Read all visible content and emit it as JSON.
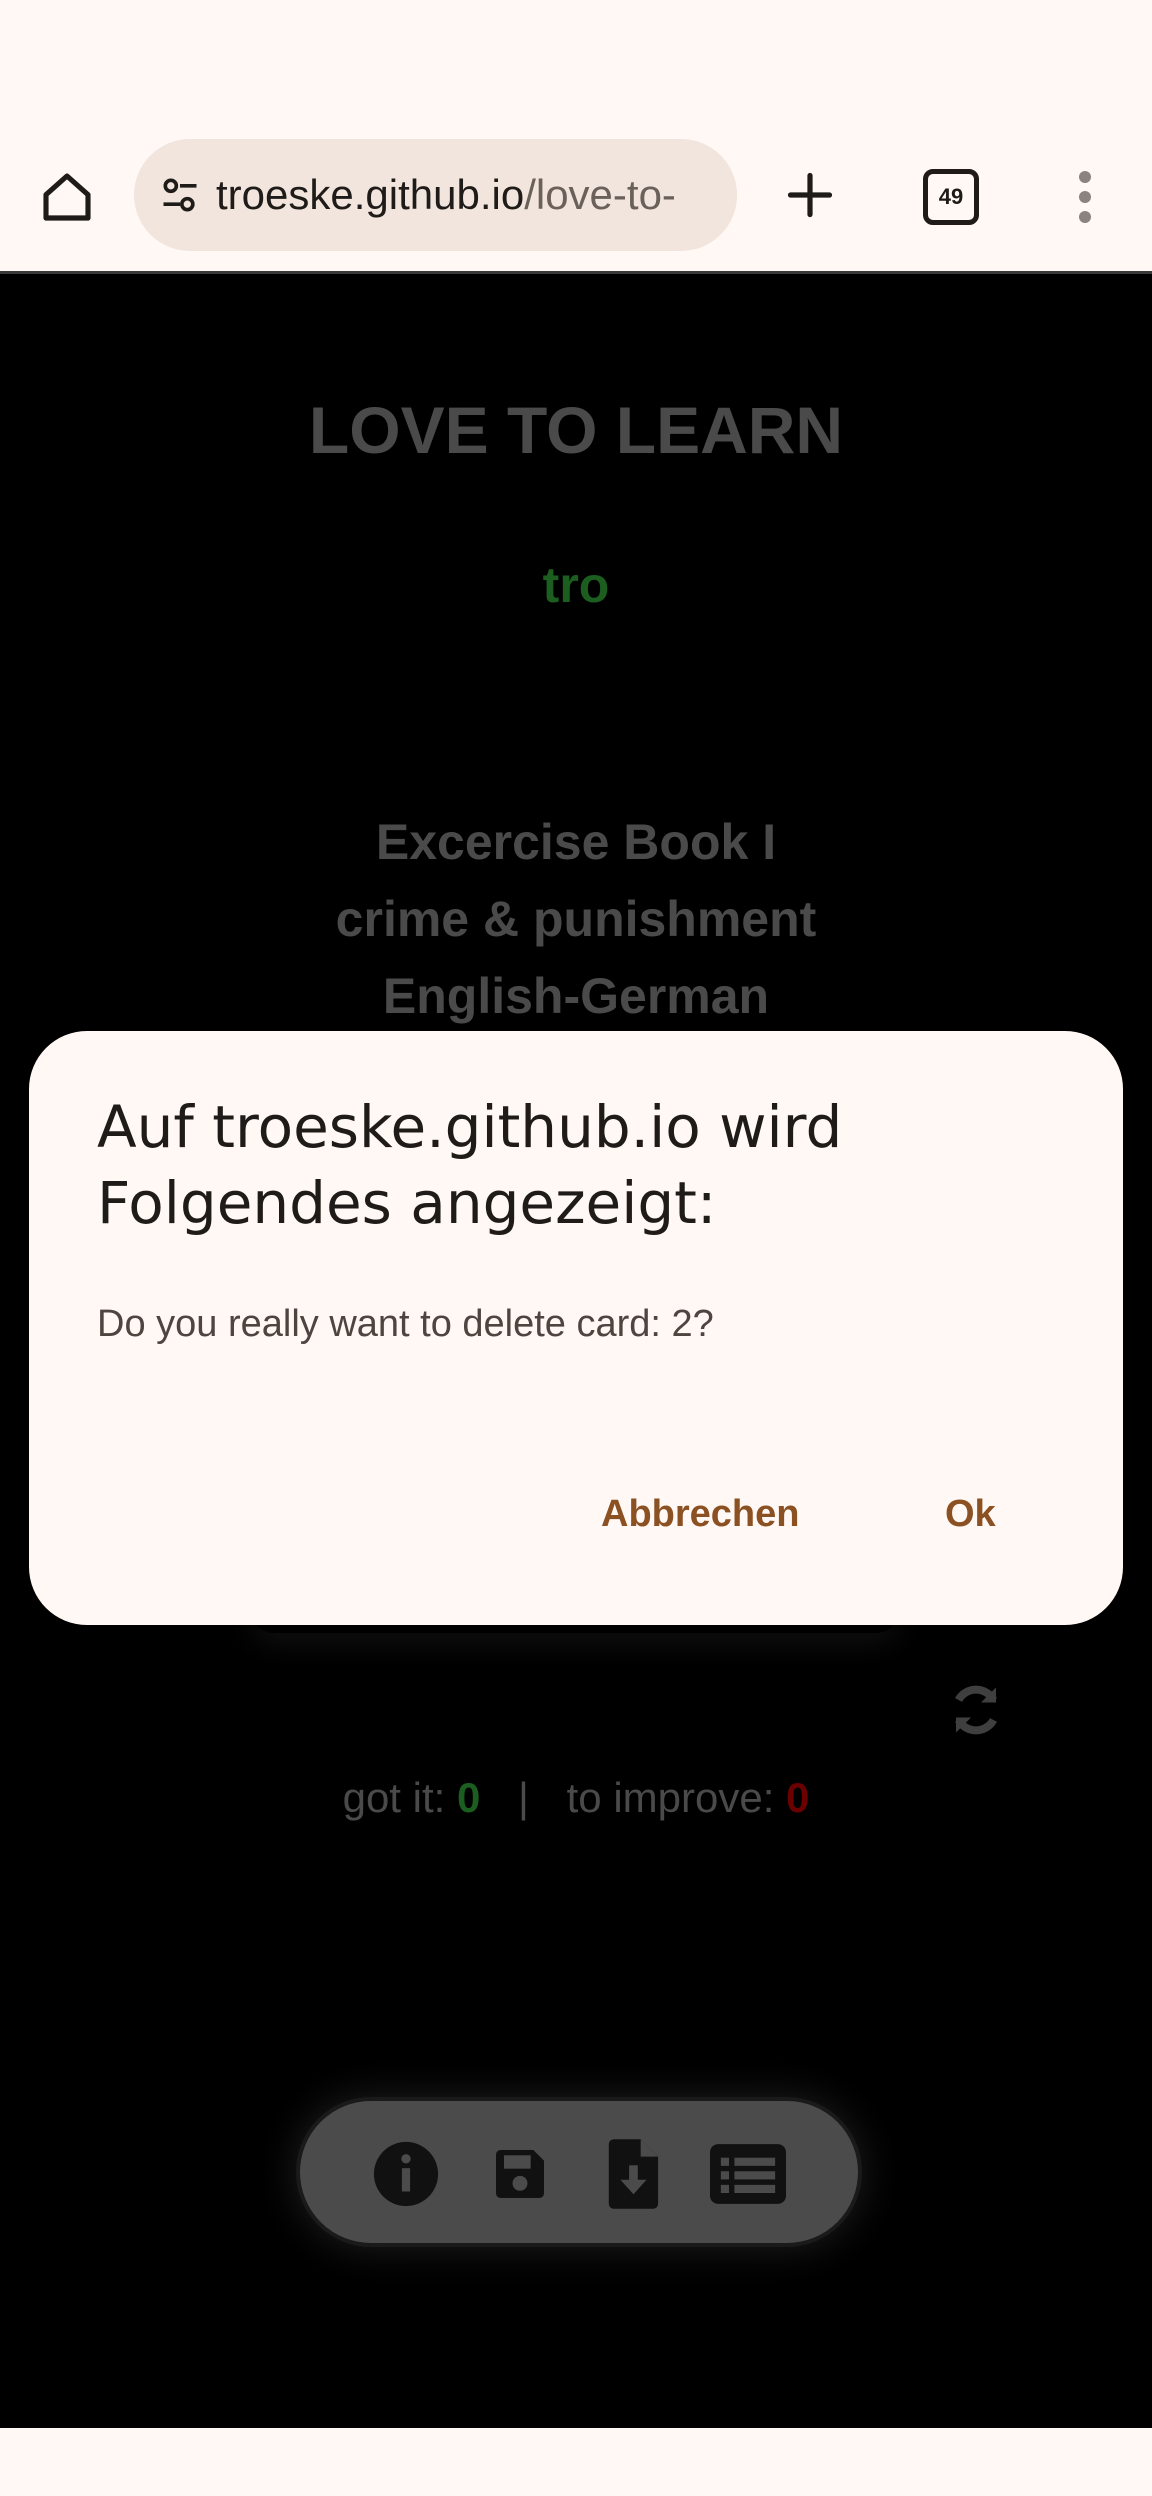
{
  "browser": {
    "url_host": "troeske.github.io",
    "url_path": "/love-to-",
    "tab_count": "49",
    "icons": {
      "home": "home-icon",
      "site_settings": "tune-icon",
      "new_tab": "plus-icon",
      "tabs": "tab-switcher-icon",
      "menu": "more-vert-icon"
    }
  },
  "page": {
    "title": "LOVE TO LEARN",
    "user": "tro",
    "book": {
      "line1": "Excercise Book I",
      "line2": "crime & punishment",
      "line3": "English-German"
    },
    "stats": {
      "got_it_label": "got it:",
      "got_it_value": "0",
      "separator": "|",
      "improve_label": "to improve:",
      "improve_value": "0"
    },
    "bottom_bar_icons": [
      "info-icon",
      "save-icon",
      "file-download-icon",
      "list-icon"
    ],
    "colors": {
      "good": "#1b5e20",
      "bad": "#6b0000",
      "muted": "#4a4a4a"
    }
  },
  "dialog": {
    "title": "Auf troeske.github.io wird Folgendes angezeigt:",
    "message": "Do you really want to delete card: 2?",
    "cancel_label": "Abbrechen",
    "ok_label": "Ok",
    "accent": "#8b5122"
  }
}
